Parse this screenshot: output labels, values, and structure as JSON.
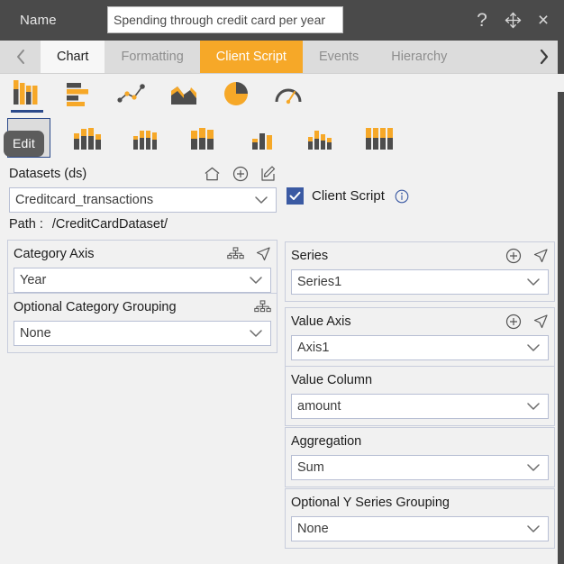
{
  "window": {
    "name_label": "Name",
    "title_value": "Spending through credit card per year",
    "actions": [
      {
        "name": "help-icon",
        "glyph": "?"
      },
      {
        "name": "move-icon",
        "glyph": "move"
      },
      {
        "name": "close-icon",
        "glyph": "×"
      }
    ]
  },
  "tabs": {
    "prev_label": "‹",
    "next_label": "›",
    "items": [
      {
        "label": "Chart",
        "state": "active-white"
      },
      {
        "label": "Formatting",
        "state": "inactive"
      },
      {
        "label": "Client Script",
        "state": "active-orange"
      },
      {
        "label": "Events",
        "state": "inactive"
      },
      {
        "label": "Hierarchy",
        "state": "inactive"
      }
    ]
  },
  "chart_types": [
    {
      "name": "column-chart-icon",
      "selected": true
    },
    {
      "name": "bar-chart-icon",
      "selected": false
    },
    {
      "name": "line-chart-icon",
      "selected": false
    },
    {
      "name": "area-chart-icon",
      "selected": false
    },
    {
      "name": "pie-chart-icon",
      "selected": false
    },
    {
      "name": "gauge-chart-icon",
      "selected": false
    }
  ],
  "chart_subtypes": [
    {
      "name": "column-stacked-icon",
      "selected": true
    },
    {
      "name": "column-stacked-grouped-icon",
      "selected": false
    },
    {
      "name": "column-stacked-thin-icon",
      "selected": false
    },
    {
      "name": "column-stacked-wide-icon",
      "selected": false
    },
    {
      "name": "column-clustered-icon",
      "selected": false
    },
    {
      "name": "column-varied-icon",
      "selected": false
    },
    {
      "name": "column-multi-stacked-icon",
      "selected": false
    }
  ],
  "tooltip": {
    "text": "Edit"
  },
  "datasets": {
    "title": "Datasets (ds)",
    "icons": [
      {
        "name": "home-icon"
      },
      {
        "name": "add-circle-icon"
      },
      {
        "name": "edit-pencil-icon"
      }
    ],
    "selected": "Creditcard_transactions",
    "path_label": "Path :",
    "path_value": "/CreditCardDataset/"
  },
  "client_script": {
    "label": "Client Script",
    "checked": true,
    "info_icon": "info-icon"
  },
  "fields": {
    "category_axis": {
      "title": "Category Axis",
      "value": "Year",
      "icons": [
        "hierarchy-icon",
        "navigate-icon"
      ]
    },
    "category_group": {
      "title": "Optional Category Grouping",
      "value": "None",
      "icons": [
        "hierarchy-icon"
      ]
    },
    "series": {
      "title": "Series",
      "value": "Series1",
      "icons": [
        "add-circle-icon",
        "navigate-icon"
      ]
    },
    "value_axis": {
      "title": "Value Axis",
      "value": "Axis1",
      "icons": [
        "add-circle-icon",
        "navigate-icon"
      ]
    },
    "value_column": {
      "title": "Value Column",
      "value": "amount",
      "icons": []
    },
    "aggregation": {
      "title": "Aggregation",
      "value": "Sum",
      "icons": []
    },
    "y_series_group": {
      "title": "Optional Y Series Grouping",
      "value": "None",
      "icons": []
    }
  },
  "colors": {
    "titlebar": "#4a4a4a",
    "accent_orange": "#f6a828",
    "accent_blue": "#2b4a8b",
    "checkbox_blue": "#3b5aa3",
    "panel_bg": "#f1f1f1",
    "tabstrip_bg": "#dcdcdc",
    "icon_gray": "#4d4d4d"
  }
}
